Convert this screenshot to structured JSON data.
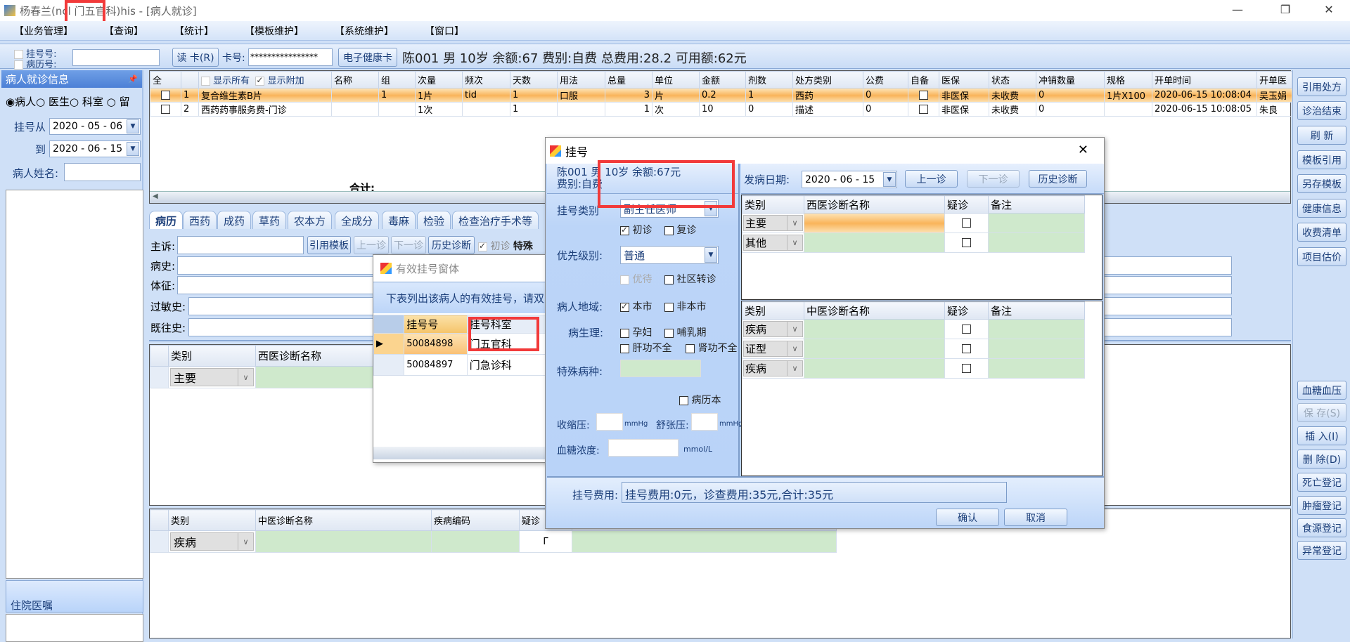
{
  "window": {
    "title_prefix": "杨春兰(n",
    "title_hidden": "cl 门五官科)",
    "title_suffix": " his - [病人就诊]",
    "minimize": "—",
    "restore": "❐",
    "close": "✕"
  },
  "menu": [
    "【业务管理】",
    "【查询】",
    "【统计】",
    "【模板维护】",
    "【系统维护】",
    "【窗口】"
  ],
  "infobar": {
    "reg_no_label": "挂号号:",
    "record_no_label": "病历号:",
    "read_card": "读 卡(R)",
    "card_label": "卡号:",
    "card_value": "****************",
    "ehealth_card": "电子健康卡",
    "patient_summary": "陈001 男 10岁 余额:67 费别:自费 总费用:28.2 可用额:62元"
  },
  "left_panel": {
    "title": "病人就诊信息",
    "pin": "📌",
    "radios": [
      {
        "label": "病人",
        "checked": true
      },
      {
        "label": "医生",
        "checked": false
      },
      {
        "label": "科室",
        "checked": false
      },
      {
        "label": "留",
        "checked": false
      }
    ],
    "from_label": "挂号从",
    "from_date": "2020 - 05 - 06",
    "to_label": "到",
    "to_date": "2020 - 06 - 15",
    "name_label": "病人姓名:",
    "name_value": "",
    "inpatient_title": "住院医嘱"
  },
  "rx_grid": {
    "show_all": "显示所有",
    "show_extra": "显示附加",
    "show_all_checked": false,
    "show_extra_checked": true,
    "columns": [
      "全",
      "",
      "",
      "名称",
      "组",
      "次量",
      "频次",
      "天数",
      "用法",
      "总量",
      "单位",
      "金额",
      "剂数",
      "处方类别",
      "公费",
      "自备",
      "医保",
      "状态",
      "冲销数量",
      "规格",
      "开单时间",
      "开单医"
    ],
    "rows": [
      [
        "",
        "1",
        "复合维生素B片",
        "",
        "1",
        "1片",
        "tid",
        "1",
        "口服",
        "3",
        "片",
        "0.2",
        "1",
        "西药",
        "0",
        "",
        "非医保",
        "未收费",
        "0",
        "1片X100",
        "2020-06-15 10:08:04",
        "吴玉娟"
      ],
      [
        "",
        "2",
        "西药药事服务费-门诊",
        "",
        "",
        "1次",
        "",
        "1",
        "",
        "1",
        "次",
        "10",
        "0",
        "描述",
        "0",
        "",
        "非医保",
        "未收费",
        "0",
        "",
        "2020-06-15 10:08:05",
        "朱良"
      ]
    ],
    "total_label": "合计:"
  },
  "tabs": [
    "病历",
    "西药",
    "成药",
    "草药",
    "农本方",
    "全成分",
    "毒麻",
    "检验",
    "检查治疗手术等"
  ],
  "record_form": {
    "complaint": "主诉:",
    "history": "病史:",
    "signs": "体征:",
    "allergy": "过敏史:",
    "past": "既往史:",
    "cite_template": "引用模板",
    "prev": "上一诊",
    "next": "下一诊",
    "history_diag": "历史诊断",
    "first_visit": "初诊",
    "special": "特殊"
  },
  "west_diag": {
    "columns": [
      "类别",
      "西医诊断名称"
    ],
    "rows": [
      {
        "type": "主要"
      }
    ]
  },
  "tcm_diag": {
    "columns": [
      "类别",
      "中医诊断名称",
      "疾病编码",
      "疑诊"
    ],
    "rows": [
      {
        "type": "疾病",
        "suspect": "Γ"
      }
    ]
  },
  "right_buttons": [
    {
      "label": "引用处方"
    },
    {
      "label": "诊治结束"
    },
    {
      "label": "刷 新"
    },
    {
      "label": "模板引用"
    },
    {
      "label": "另存模板"
    },
    {
      "label": "健康信息"
    },
    {
      "label": "收费清单"
    },
    {
      "label": "项目估价"
    }
  ],
  "right_buttons_lower": [
    {
      "label": "血糖血压",
      "disabled": false
    },
    {
      "label": "保 存(S)",
      "disabled": true
    },
    {
      "label": "插 入(I)",
      "disabled": false
    },
    {
      "label": "删 除(D)",
      "disabled": false
    },
    {
      "label": "死亡登记",
      "disabled": false
    },
    {
      "label": "肿瘤登记",
      "disabled": false
    },
    {
      "label": "食源登记",
      "disabled": false
    },
    {
      "label": "异常登记",
      "disabled": false
    }
  ],
  "valid_reg_dialog": {
    "title": "有效挂号窗体",
    "hint": "下表列出该病人的有效挂号，请双",
    "columns": [
      "挂号号",
      "挂号科室"
    ],
    "rows": [
      [
        "50084898",
        "门五官科"
      ],
      [
        "50084897",
        "门急诊科"
      ]
    ]
  },
  "reg_dialog": {
    "title": "挂号",
    "close": "✕",
    "patient_line1": "陈001 男 10岁 余额:67元",
    "patient_line2": "费别:自费",
    "reg_type_label": "挂号类别",
    "reg_type_value": "副主任医师",
    "first_visit": "初诊",
    "first_visit_checked": true,
    "revisit": "复诊",
    "revisit_checked": false,
    "priority_label": "优先级别:",
    "priority_value": "普通",
    "preferential": "优待",
    "referral": "社区转诊",
    "region_label": "病人地域:",
    "local": "本市",
    "local_checked": true,
    "nonlocal": "非本市",
    "physio_label": "病生理:",
    "pregnant": "孕妇",
    "lactation": "哺乳期",
    "liver": "肝功不全",
    "kidney": "肾功不全",
    "special_disease_label": "特殊病种:",
    "record_book": "病历本",
    "systolic_label": "收缩压:",
    "diastolic_label": "舒张压:",
    "unit_mmhg": "mmHg",
    "glucose_label": "血糖浓度:",
    "unit_glucose": "mmol/L",
    "onset_label": "发病日期:",
    "onset_date": "2020 - 06 - 15",
    "prev": "上一诊",
    "next": "下一诊",
    "history_diag": "历史诊断",
    "west_columns": [
      "类别",
      "西医诊断名称",
      "疑诊",
      "备注"
    ],
    "west_rows": [
      "主要",
      "其他"
    ],
    "tcm_columns": [
      "类别",
      "中医诊断名称",
      "疑诊",
      "备注"
    ],
    "tcm_rows": [
      "疾病",
      "证型",
      "疾病"
    ],
    "fee_label": "挂号费用:",
    "fee_value": "挂号费用:0元，诊查费用:35元,合计:35元",
    "confirm": "确认",
    "cancel": "取消"
  },
  "colors": {
    "accent": "#4c80d6",
    "highlight_box": "#f23a3a",
    "selected_row": "#f9b45a",
    "editable_cell": "#cfe9cc"
  }
}
